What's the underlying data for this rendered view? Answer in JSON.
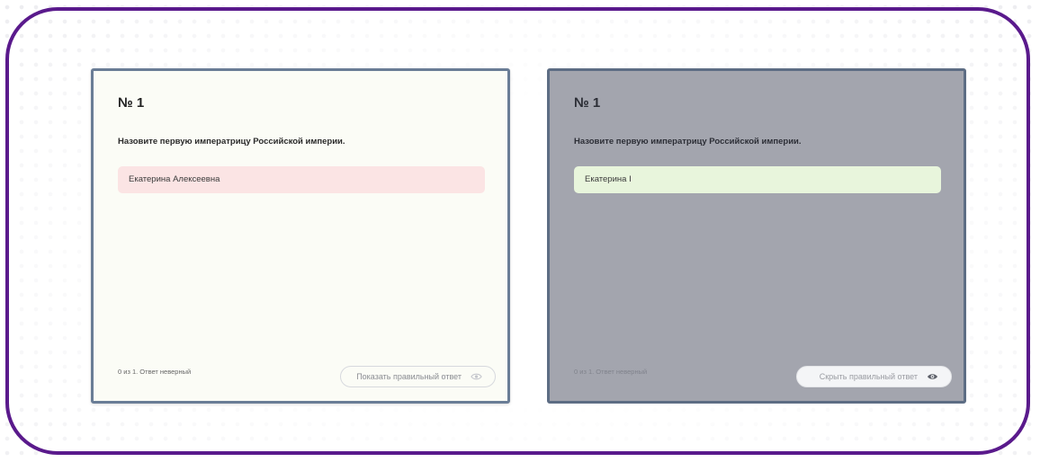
{
  "cards": [
    {
      "number": "№ 1",
      "question": "Назовите первую императрицу Российской империи.",
      "answer": "Екатерина Алексеевна",
      "status": "0 из 1. Ответ неверный",
      "toggle_label": "Показать правильный ответ",
      "toggle_icon": "eye-icon",
      "answer_bg": "#fbe4e4"
    },
    {
      "number": "№ 1",
      "question": "Назовите первую императрицу Российской империи.",
      "answer": "Екатерина I",
      "status": "0 из 1. Ответ неверный",
      "toggle_label": "Скрыть правильный ответ",
      "toggle_icon": "eye-icon",
      "answer_bg": "#e8f5dc"
    }
  ],
  "colors": {
    "frame_border": "#5a1a8c",
    "left_card_bg": "#fbfcf6",
    "right_card_bg": "#a3a5ae"
  }
}
